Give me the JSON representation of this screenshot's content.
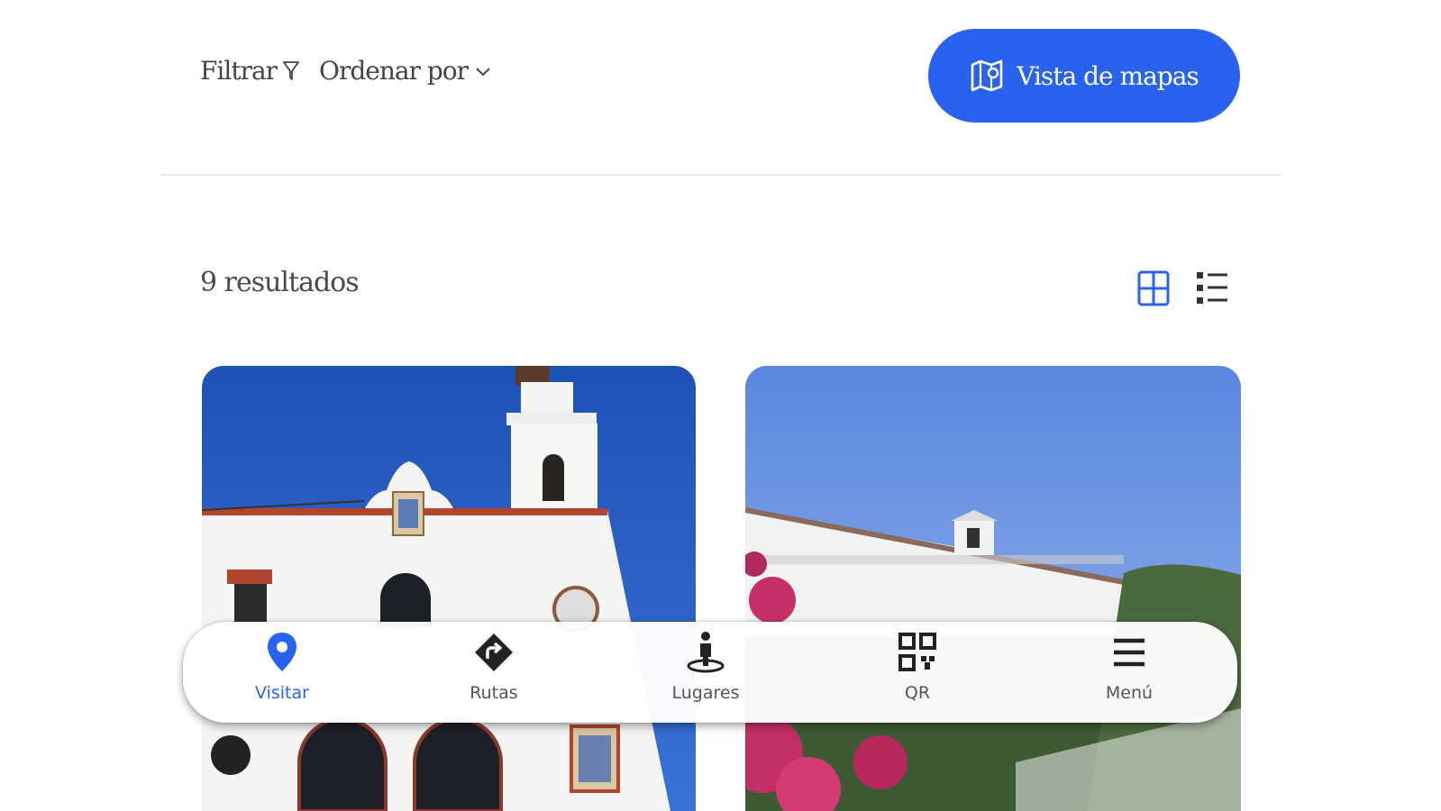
{
  "toolbar": {
    "filter_label": "Filtrar",
    "filter_icon": "funnel-icon",
    "sort_label": "Ordenar por",
    "sort_icon": "chevron-down-icon",
    "map_view_label": "Vista de mapas",
    "map_view_icon": "map-icon"
  },
  "results": {
    "count_label": "9 resultados",
    "view_modes": [
      {
        "name": "grid-view",
        "icon": "grid-icon",
        "active": true
      },
      {
        "name": "list-view",
        "icon": "list-icon",
        "active": false
      }
    ]
  },
  "cards": [
    {
      "image": "white-chapel-with-bell-tower"
    },
    {
      "image": "white-church-with-bougainvillea"
    }
  ],
  "bottom_nav": {
    "items": [
      {
        "label": "Visitar",
        "icon": "location-pin-icon",
        "active": true
      },
      {
        "label": "Rutas",
        "icon": "route-sign-icon",
        "active": false
      },
      {
        "label": "Lugares",
        "icon": "person-pin-icon",
        "active": false
      },
      {
        "label": "QR",
        "icon": "qr-code-icon",
        "active": false
      },
      {
        "label": "Menú",
        "icon": "hamburger-menu-icon",
        "active": false
      }
    ]
  },
  "colors": {
    "accent": "#2a62f0",
    "text": "#444444",
    "divider": "#ececec"
  }
}
